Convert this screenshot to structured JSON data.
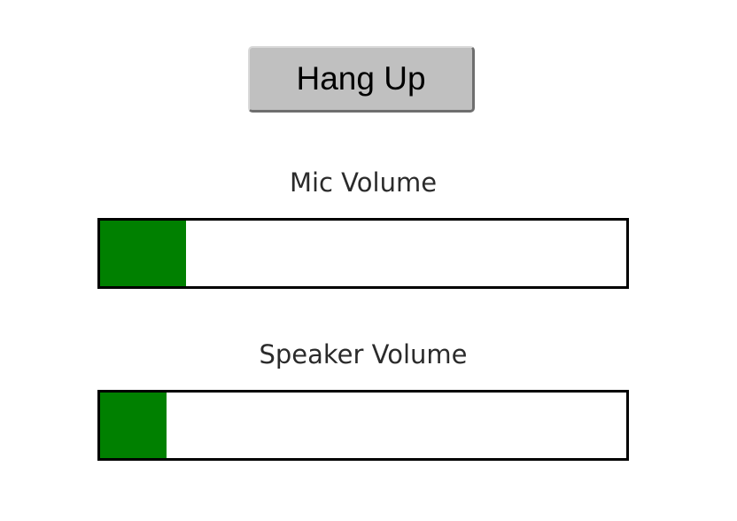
{
  "controls": {
    "hangup_label": "Hang Up"
  },
  "mic": {
    "label": "Mic Volume",
    "level_fraction": 0.163,
    "fill_color": "#008000"
  },
  "speaker": {
    "label": "Speaker Volume",
    "level_fraction": 0.126,
    "fill_color": "#008000"
  }
}
